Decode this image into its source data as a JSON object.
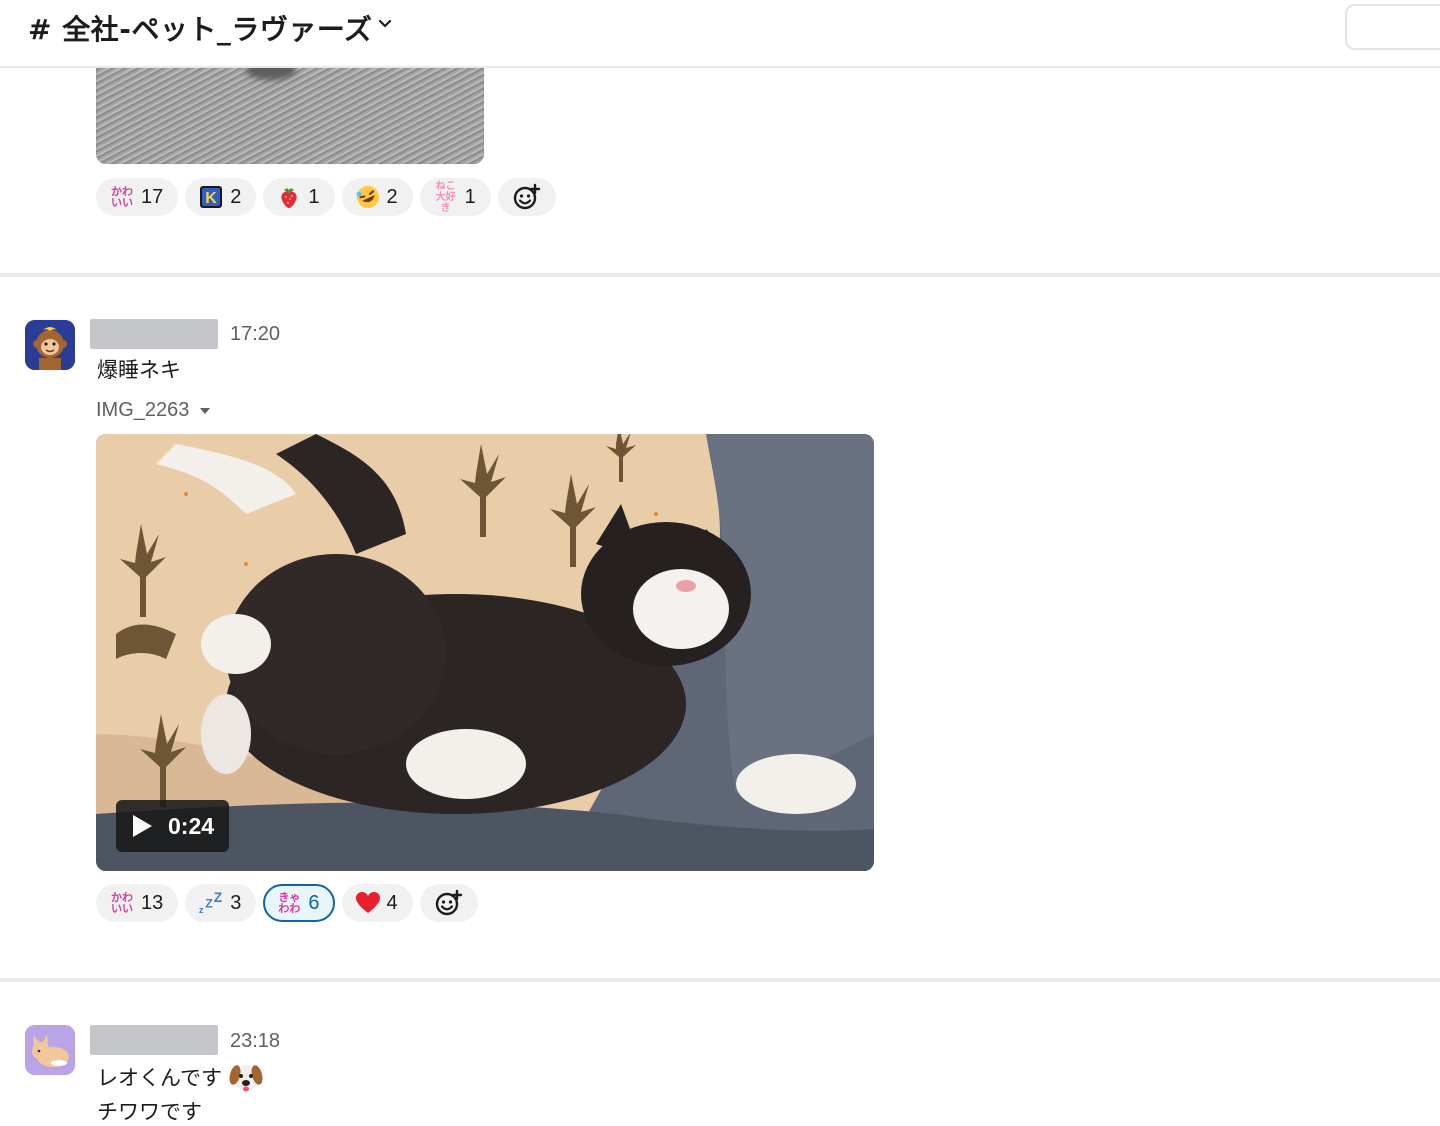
{
  "header": {
    "channel_name": "# 全社-ペット_ラヴァーズ"
  },
  "message_prev": {
    "reactions": [
      {
        "emoji_name": "kawaii-text",
        "emoji_text": "かわいい",
        "count": "17"
      },
      {
        "emoji_name": "k-logo-icon",
        "emoji_text": "K",
        "count": "2"
      },
      {
        "emoji_name": "strawberry-icon",
        "emoji_text": "",
        "count": "1"
      },
      {
        "emoji_name": "rofl-icon",
        "emoji_text": "",
        "count": "2"
      },
      {
        "emoji_name": "neko-daisuki-text",
        "emoji_text": "ねこ大好き",
        "count": "1"
      }
    ]
  },
  "message_1": {
    "time": "17:20",
    "text": "爆睡ネキ",
    "file_name": "IMG_2263",
    "video_duration": "0:24",
    "reactions": [
      {
        "emoji_name": "kawaii-text",
        "emoji_text": "かわいい",
        "count": "13"
      },
      {
        "emoji_name": "zzz-icon",
        "emoji_text": "zZZ",
        "count": "3"
      },
      {
        "emoji_name": "kyawawa-text",
        "emoji_text": "きゃわわ",
        "count": "6",
        "active": true
      },
      {
        "emoji_name": "heart-icon",
        "emoji_text": "",
        "count": "4"
      }
    ]
  },
  "message_2": {
    "time": "23:18",
    "text_line1": "レオくんです",
    "text_line1_emoji": "dog-face-icon",
    "text_line2": "チワワです"
  },
  "colors": {
    "accent_blue": "#1264a3",
    "reaction_bg": "#f1f1f1",
    "timestamp": "#616061",
    "kawaii_pink": "#e0359f"
  }
}
